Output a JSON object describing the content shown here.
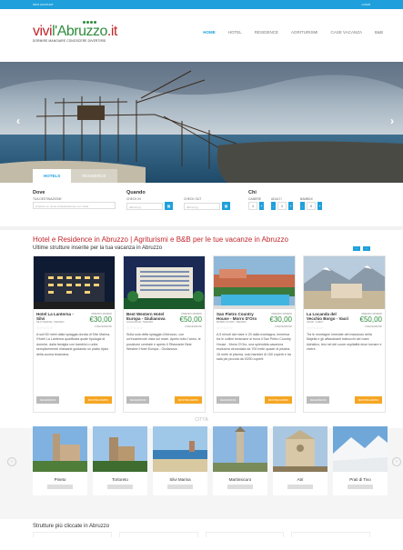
{
  "topbar": {
    "left": "INFO ACCOUNT",
    "right": "LOGIN"
  },
  "logo": {
    "vivi": "vivi",
    "abruzzo": "l'Abruzzo",
    "it": ".it",
    "sub": "DORMIRE MANGIARE CONOSCERE DIVERTIRSI"
  },
  "nav": [
    "HOME",
    "HOTEL",
    "RESIDENCE",
    "AGRITURISMI",
    "CASE VACANZA",
    "B&B"
  ],
  "tabs": {
    "hotels": "HOTELS",
    "second": "RESIDENCE"
  },
  "search": {
    "dove": {
      "title": "Dove",
      "label": "TUA DESTINAZIONE",
      "placeholder": "inserisci un nome di destinazione o un hotel"
    },
    "quando": {
      "title": "Quando",
      "in_label": "CHECK IN",
      "out_label": "CHECK OUT",
      "in_value": "dd/mm/yy",
      "out_value": "dd/mm/yy"
    },
    "chi": {
      "title": "Chi",
      "camere_label": "CAMERE",
      "adulti_label": "ADULTI",
      "bambini_label": "BAMBINI",
      "camere": "1",
      "adulti": "1",
      "bambini": "0"
    }
  },
  "headline": "Hotel e Residence in Abruzzo | Agriturismi e B&B per le tue vacanze in Abruzzo",
  "subhead": "Ultime strutture inserite per la tua vacanza in Abruzzo",
  "cards": [
    {
      "name": "Hotel La Lanterna - Silvi",
      "loc": "SILVI MARINA, TERAMO",
      "plabel": "PREZZO MINIMO",
      "price": "€30,00",
      "rating": "0 RECENSIONI",
      "desc": "A soli 50 metri dalla spiaggia dorata di Silvi Marina, l'Hotel La Lanterna qualificata quale tipologia di dormire, dalla famiglia con bambini o unita semplicemente rilassanti guidando un piatto tipico della cucina teramana.",
      "b1": "RECENSIONI",
      "b2": "MOSTRA MAPPA"
    },
    {
      "name": "Best Western Hotel Europa - Giulianova",
      "loc": "GIULIANOVA, TERAMO",
      "plabel": "PREZZO MINIMO",
      "price": "€50,00",
      "rating": "0 RECENSIONI",
      "desc": "Sulla sola della spiaggia d'Abruzzo, con un'incantevole vista sul mare. Aperto tutto l'anno, le posizione centrale e aperto Il Ristorante Best Western Hotel Europa - Giulianova.",
      "b1": "RECENSIONI",
      "b2": "MOSTRA MAPPA"
    },
    {
      "name": "San Pietro Country House - Morro D'Oro",
      "loc": "MORRO D'ORO, TERAMO",
      "plabel": "PREZZO MINIMO",
      "price": "€30,00",
      "rating": "0 RECENSIONI",
      "desc": "A 5 minuti dal mare e 20 dalla montagna, immersa tra le colline teramane si trova il San Pietro Country House - Morro D'Oro, una splendida casa/una esclusiva circondata da 700 metri quadri di piscina, 15 metri di piscina, solo bambini di 150 coperti e tra sala più piccola da 20/30 coperti.",
      "b1": "RECENSIONI",
      "b2": "MOSTRA MAPPA"
    },
    {
      "name": "La Locanda del Vecchio Borgo - Vacri",
      "loc": "VACRI, CHIETI",
      "plabel": "PREZZO MINIMO",
      "price": "€50,00",
      "rating": "0 RECENSIONI",
      "desc": "Tra le montagne innevate del massiccio della Majella e gli affascinanti trabocchi del mare Adriatico, tesi nel del cuore ospitalità dove tornare e vivere.",
      "b1": "RECENSIONI",
      "b2": "MOSTRA MAPPA"
    }
  ],
  "cities_label": "CITTÀ",
  "cities": [
    {
      "name": "Pineto"
    },
    {
      "name": "Tortoreto"
    },
    {
      "name": "Silvi Marina"
    },
    {
      "name": "Martinsicuro"
    },
    {
      "name": "Atri"
    },
    {
      "name": "Prati di Tivo"
    }
  ],
  "most_clicked": "Strutture più cliccate in Abruzzo",
  "colors": {
    "accent": "#1fa0dc",
    "brand_red": "#c0272d",
    "price_green": "#2e8b3d",
    "map_btn": "#f5a623"
  }
}
